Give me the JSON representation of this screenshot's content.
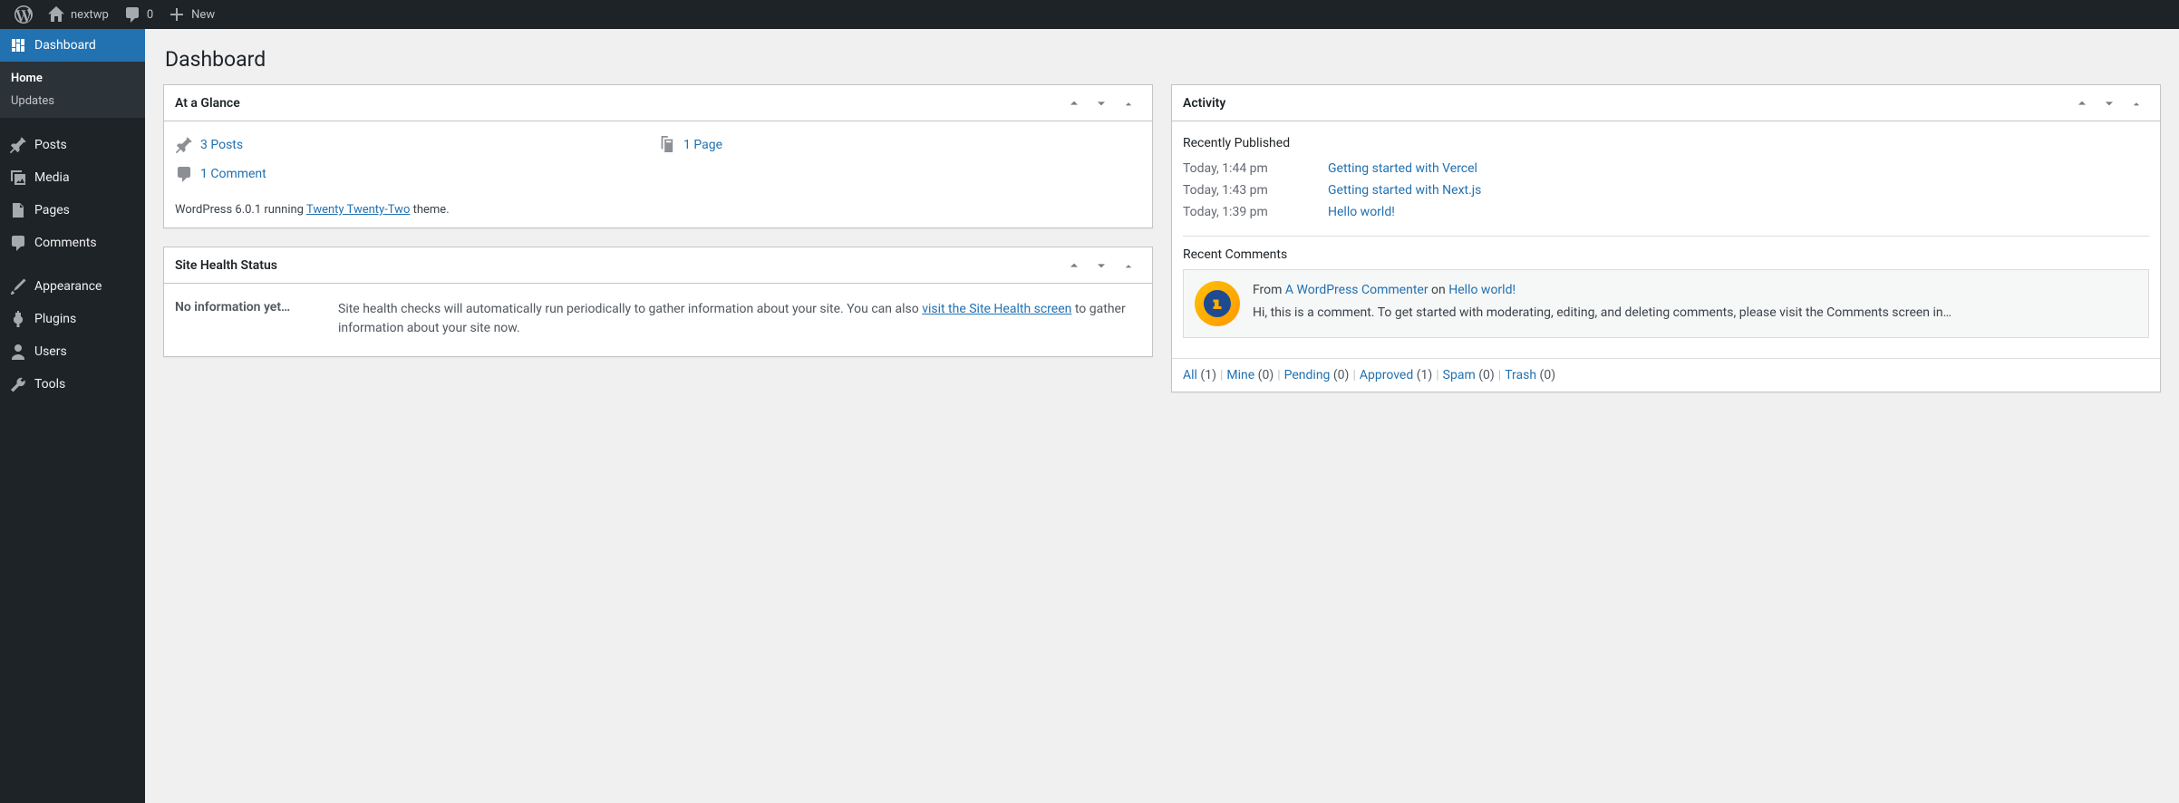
{
  "toolbar": {
    "site_name": "nextwp",
    "comment_count": "0",
    "new_label": "New"
  },
  "sidebar": {
    "items": [
      {
        "id": "dashboard",
        "label": "Dashboard"
      },
      {
        "id": "posts",
        "label": "Posts"
      },
      {
        "id": "media",
        "label": "Media"
      },
      {
        "id": "pages",
        "label": "Pages"
      },
      {
        "id": "comments",
        "label": "Comments"
      },
      {
        "id": "appearance",
        "label": "Appearance"
      },
      {
        "id": "plugins",
        "label": "Plugins"
      },
      {
        "id": "users",
        "label": "Users"
      },
      {
        "id": "tools",
        "label": "Tools"
      }
    ],
    "submenu": {
      "home": "Home",
      "updates": "Updates"
    }
  },
  "page": {
    "title": "Dashboard"
  },
  "glance": {
    "title": "At a Glance",
    "posts": "3 Posts",
    "page": "1 Page",
    "comment": "1 Comment",
    "version_prefix": "WordPress 6.0.1 running ",
    "theme": "Twenty Twenty-Two",
    "version_suffix": " theme."
  },
  "health": {
    "title": "Site Health Status",
    "no_info": "No information yet…",
    "desc_before": "Site health checks will automatically run periodically to gather information about your site. You can also ",
    "link": "visit the Site Health screen",
    "desc_after": " to gather information about your site now."
  },
  "activity": {
    "title": "Activity",
    "recently_published": "Recently Published",
    "posts": [
      {
        "time": "Today, 1:44 pm",
        "title": "Getting started with Vercel"
      },
      {
        "time": "Today, 1:43 pm",
        "title": "Getting started with Next.js"
      },
      {
        "time": "Today, 1:39 pm",
        "title": "Hello world!"
      }
    ],
    "recent_comments": "Recent Comments",
    "comment": {
      "from": "From ",
      "author": "A WordPress Commenter",
      "on": " on ",
      "post": "Hello world!",
      "excerpt": "Hi, this is a comment. To get started with moderating, editing, and deleting comments, please visit the Comments screen in…"
    },
    "filters": [
      {
        "label": "All",
        "count": "(1)"
      },
      {
        "label": "Mine",
        "count": "(0)"
      },
      {
        "label": "Pending",
        "count": "(0)"
      },
      {
        "label": "Approved",
        "count": "(1)"
      },
      {
        "label": "Spam",
        "count": "(0)"
      },
      {
        "label": "Trash",
        "count": "(0)"
      }
    ]
  }
}
